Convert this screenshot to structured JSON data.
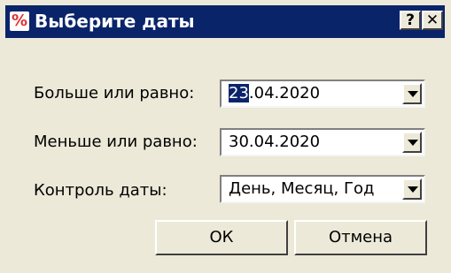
{
  "window": {
    "title": "Выберите даты",
    "icon": "percent-icon",
    "help_label": "?",
    "close_label": "✕"
  },
  "fields": [
    {
      "label": "Больше или равно:",
      "value_selected": "23",
      "value_rest": ".04.2020"
    },
    {
      "label": "Меньше или равно:",
      "value": "30.04.2020"
    },
    {
      "label": "Контроль даты:",
      "value": "День, Месяц, Год"
    }
  ],
  "buttons": {
    "ok": "ОК",
    "cancel": "Отмена"
  },
  "colors": {
    "titlebar": "#0a246a",
    "face": "#ece9d8",
    "selection": "#0a246a"
  }
}
